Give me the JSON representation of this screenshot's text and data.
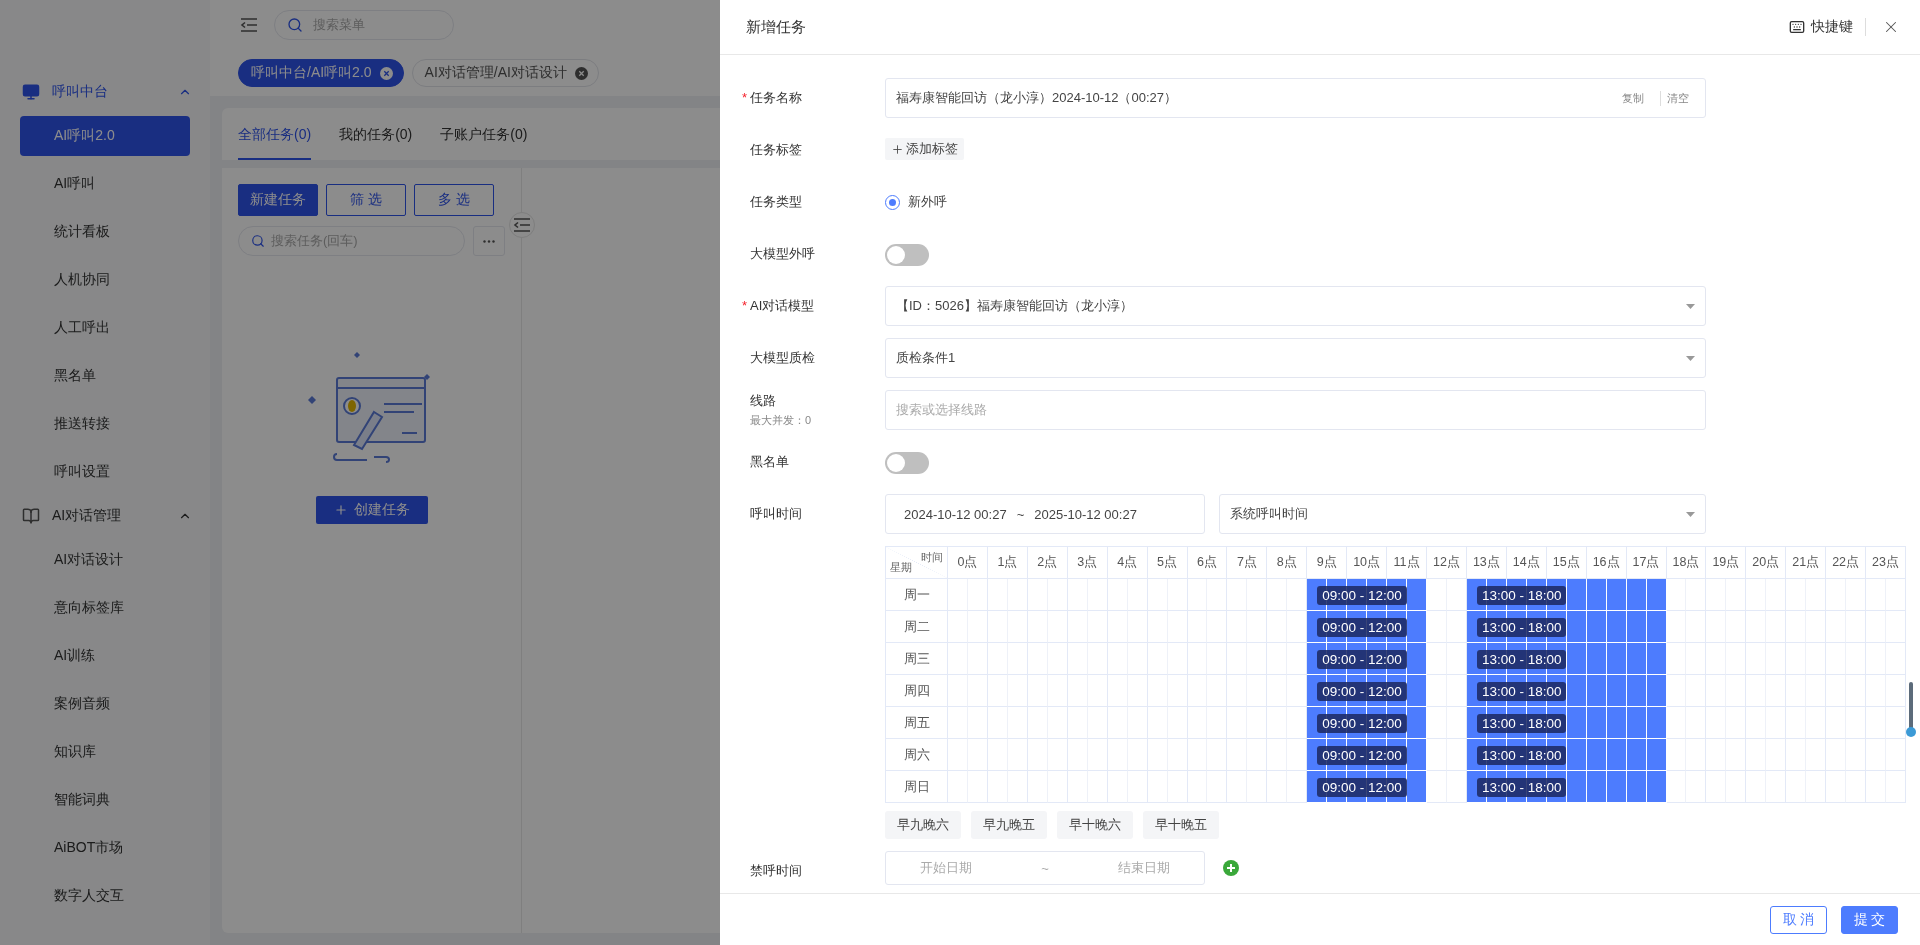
{
  "sidebar": {
    "groups": [
      {
        "label": "呼叫中台",
        "kind": "monitor",
        "expanded": true,
        "selected": true,
        "items": [
          {
            "label": "AI呼叫2.0",
            "selected": true
          },
          {
            "label": "AI呼叫",
            "selected": false
          },
          {
            "label": "统计看板",
            "selected": false
          },
          {
            "label": "人机协同",
            "selected": false
          },
          {
            "label": "人工呼出",
            "selected": false
          },
          {
            "label": "黑名单",
            "selected": false
          },
          {
            "label": "推送转接",
            "selected": false
          },
          {
            "label": "呼叫设置",
            "selected": false
          }
        ]
      },
      {
        "label": "AI对话管理",
        "kind": "book",
        "expanded": true,
        "selected": false,
        "items": [
          {
            "label": "AI对话设计",
            "selected": false
          },
          {
            "label": "意向标签库",
            "selected": false
          },
          {
            "label": "AI训练",
            "selected": false
          },
          {
            "label": "案例音频",
            "selected": false
          },
          {
            "label": "知识库",
            "selected": false
          },
          {
            "label": "智能词典",
            "selected": false
          },
          {
            "label": "AiBOT市场",
            "selected": false
          },
          {
            "label": "数字人交互",
            "selected": false
          }
        ]
      }
    ]
  },
  "topbar": {
    "search": {
      "placeholder": "搜索菜单"
    }
  },
  "open_tabs": [
    {
      "label": "呼叫中台/AI呼叫2.0",
      "selected": true
    },
    {
      "label": "AI对话管理/AI对话设计",
      "selected": false
    }
  ],
  "task_tabs": [
    {
      "label": "全部任务(0)",
      "selected": true
    },
    {
      "label": "我的任务(0)",
      "selected": false
    },
    {
      "label": "子账户任务(0)",
      "selected": false
    }
  ],
  "task_panel": {
    "buttons": [
      {
        "label": "新建任务",
        "kind": "primary"
      },
      {
        "label": "筛 选",
        "kind": "outline"
      },
      {
        "label": "多 选",
        "kind": "outline"
      }
    ],
    "search": {
      "placeholder": "搜索任务(回车)"
    },
    "empty_action": "创建任务"
  },
  "drawer": {
    "title": "新增任务",
    "shortcut": "快捷键",
    "form": [
      {
        "kind": "text",
        "label": "任务名称",
        "required_mark": "*",
        "value": "福寿康智能回访（龙小淳）2024-10-12（00:27）",
        "actions": [
          "复制",
          "清空"
        ]
      },
      {
        "kind": "tags",
        "label": "任务标签",
        "add": "添加标签"
      },
      {
        "kind": "radio",
        "label": "任务类型",
        "options": [
          {
            "label": "新外呼",
            "selected": true
          }
        ]
      },
      {
        "kind": "switch",
        "label": "大模型外呼",
        "on": false
      },
      {
        "kind": "select",
        "label": "AI对话模型",
        "required_mark": "*",
        "value": "【ID：5026】福寿康智能回访（龙小淳）"
      },
      {
        "kind": "select",
        "label": "大模型质检",
        "value": "质检条件1"
      },
      {
        "kind": "search",
        "label": "线路",
        "sublabel": "最大并发：0",
        "placeholder": "搜索或选择线路"
      },
      {
        "kind": "switch",
        "label": "黑名单",
        "on": false
      },
      {
        "kind": "period",
        "label": "呼叫时间",
        "start": "2024-10-12 00:27",
        "separator": "~",
        "end": "2025-10-12 00:27",
        "mode": "系统呼叫时间"
      },
      {
        "kind": "schedule",
        "corner_top": "时间",
        "corner_bottom": "星期",
        "hours": [
          "0点",
          "1点",
          "2点",
          "3点",
          "4点",
          "5点",
          "6点",
          "7点",
          "8点",
          "9点",
          "10点",
          "11点",
          "12点",
          "13点",
          "14点",
          "15点",
          "16点",
          "17点",
          "18点",
          "19点",
          "20点",
          "21点",
          "22点",
          "23点"
        ],
        "days": [
          {
            "label": "周一",
            "ranges": [
              "09:00 - 12:00",
              "13:00 - 18:00"
            ],
            "slots": [
              false,
              false,
              false,
              false,
              false,
              false,
              false,
              false,
              false,
              false,
              false,
              false,
              false,
              false,
              false,
              false,
              false,
              false,
              true,
              true,
              true,
              true,
              true,
              true,
              false,
              false,
              true,
              true,
              true,
              true,
              true,
              true,
              true,
              true,
              true,
              true,
              false,
              false,
              false,
              false,
              false,
              false,
              false,
              false,
              false,
              false,
              false,
              false
            ]
          },
          {
            "label": "周二",
            "ranges": [
              "09:00 - 12:00",
              "13:00 - 18:00"
            ],
            "slots": [
              false,
              false,
              false,
              false,
              false,
              false,
              false,
              false,
              false,
              false,
              false,
              false,
              false,
              false,
              false,
              false,
              false,
              false,
              true,
              true,
              true,
              true,
              true,
              true,
              false,
              false,
              true,
              true,
              true,
              true,
              true,
              true,
              true,
              true,
              true,
              true,
              false,
              false,
              false,
              false,
              false,
              false,
              false,
              false,
              false,
              false,
              false,
              false
            ]
          },
          {
            "label": "周三",
            "ranges": [
              "09:00 - 12:00",
              "13:00 - 18:00"
            ],
            "slots": [
              false,
              false,
              false,
              false,
              false,
              false,
              false,
              false,
              false,
              false,
              false,
              false,
              false,
              false,
              false,
              false,
              false,
              false,
              true,
              true,
              true,
              true,
              true,
              true,
              false,
              false,
              true,
              true,
              true,
              true,
              true,
              true,
              true,
              true,
              true,
              true,
              false,
              false,
              false,
              false,
              false,
              false,
              false,
              false,
              false,
              false,
              false,
              false
            ]
          },
          {
            "label": "周四",
            "ranges": [
              "09:00 - 12:00",
              "13:00 - 18:00"
            ],
            "slots": [
              false,
              false,
              false,
              false,
              false,
              false,
              false,
              false,
              false,
              false,
              false,
              false,
              false,
              false,
              false,
              false,
              false,
              false,
              true,
              true,
              true,
              true,
              true,
              true,
              false,
              false,
              true,
              true,
              true,
              true,
              true,
              true,
              true,
              true,
              true,
              true,
              false,
              false,
              false,
              false,
              false,
              false,
              false,
              false,
              false,
              false,
              false,
              false
            ]
          },
          {
            "label": "周五",
            "ranges": [
              "09:00 - 12:00",
              "13:00 - 18:00"
            ],
            "slots": [
              false,
              false,
              false,
              false,
              false,
              false,
              false,
              false,
              false,
              false,
              false,
              false,
              false,
              false,
              false,
              false,
              false,
              false,
              true,
              true,
              true,
              true,
              true,
              true,
              false,
              false,
              true,
              true,
              true,
              true,
              true,
              true,
              true,
              true,
              true,
              true,
              false,
              false,
              false,
              false,
              false,
              false,
              false,
              false,
              false,
              false,
              false,
              false
            ]
          },
          {
            "label": "周六",
            "ranges": [
              "09:00 - 12:00",
              "13:00 - 18:00"
            ],
            "slots": [
              false,
              false,
              false,
              false,
              false,
              false,
              false,
              false,
              false,
              false,
              false,
              false,
              false,
              false,
              false,
              false,
              false,
              false,
              true,
              true,
              true,
              true,
              true,
              true,
              false,
              false,
              true,
              true,
              true,
              true,
              true,
              true,
              true,
              true,
              true,
              true,
              false,
              false,
              false,
              false,
              false,
              false,
              false,
              false,
              false,
              false,
              false,
              false
            ]
          },
          {
            "label": "周日",
            "ranges": [
              "09:00 - 12:00",
              "13:00 - 18:00"
            ],
            "slots": [
              false,
              false,
              false,
              false,
              false,
              false,
              false,
              false,
              false,
              false,
              false,
              false,
              false,
              false,
              false,
              false,
              false,
              false,
              true,
              true,
              true,
              true,
              true,
              true,
              false,
              false,
              true,
              true,
              true,
              true,
              true,
              true,
              true,
              true,
              true,
              true,
              false,
              false,
              false,
              false,
              false,
              false,
              false,
              false,
              false,
              false,
              false,
              false
            ]
          }
        ],
        "presets": [
          "早九晚六",
          "早九晚五",
          "早十晚六",
          "早十晚五"
        ]
      },
      {
        "kind": "daterange",
        "label": "禁呼时间",
        "start_placeholder": "开始日期",
        "separator": "~",
        "end_placeholder": "结束日期"
      }
    ],
    "footer": [
      {
        "label": "取 消",
        "kind": "secondary"
      },
      {
        "label": "提 交",
        "kind": "primary"
      }
    ]
  }
}
